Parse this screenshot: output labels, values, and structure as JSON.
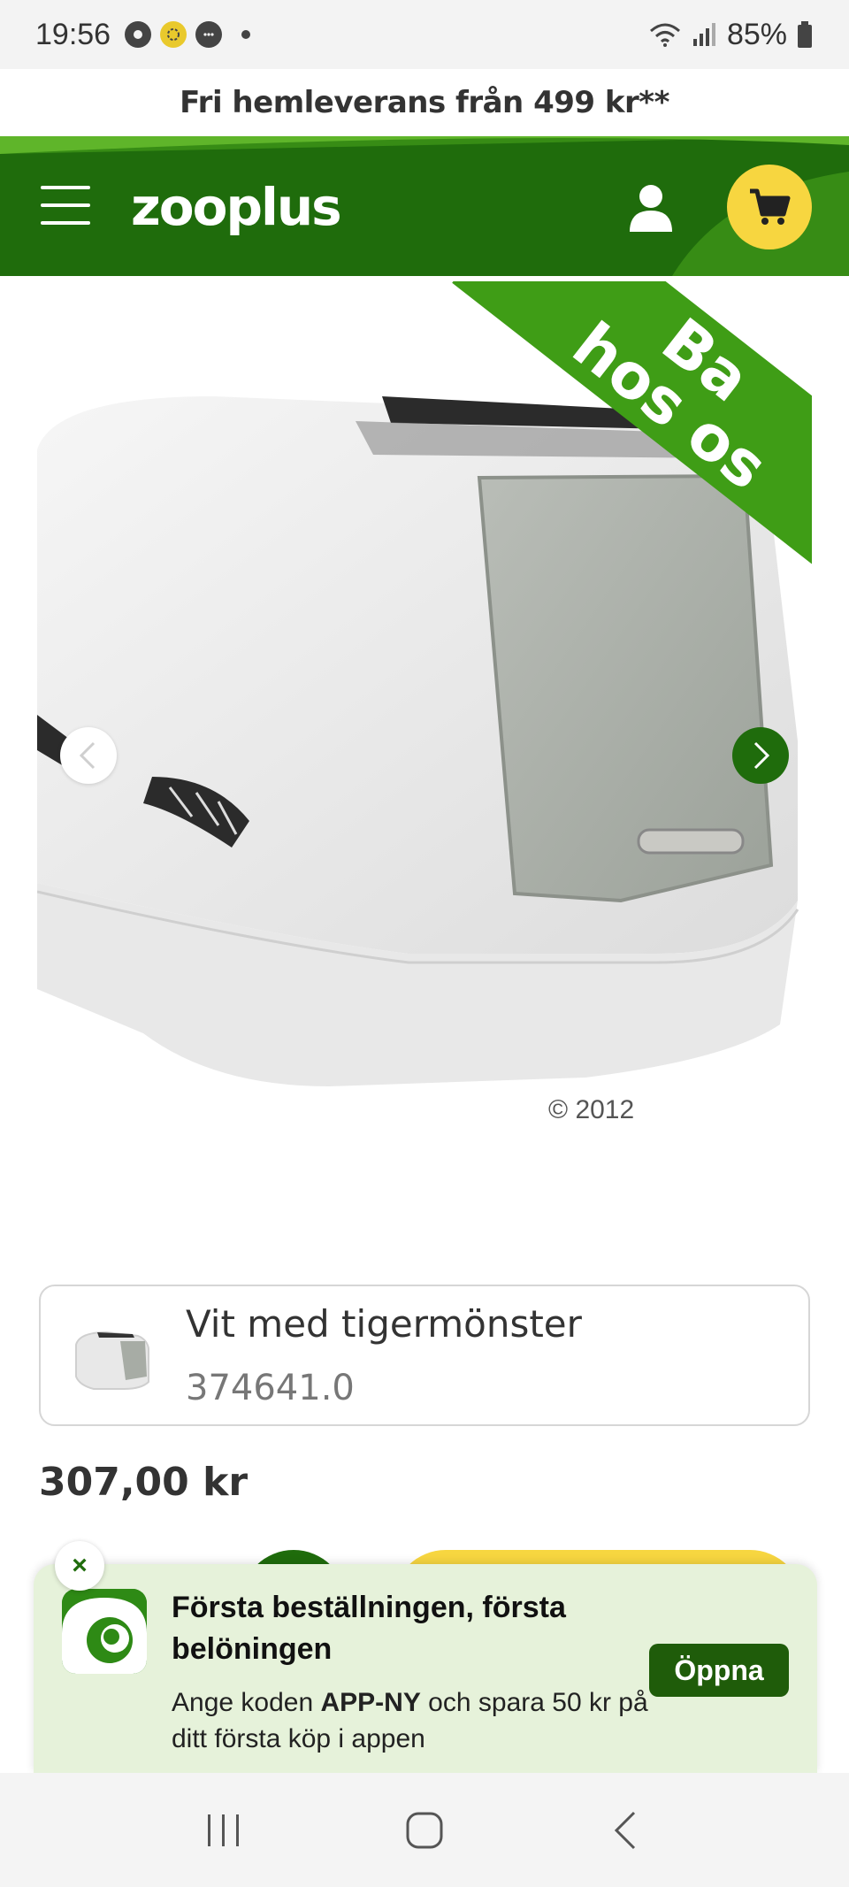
{
  "status_bar": {
    "time": "19:56",
    "battery": "85%",
    "icons": [
      "app-icon",
      "app-icon",
      "chat-icon",
      "dot",
      "wifi-icon",
      "signal-icon",
      "battery-icon"
    ]
  },
  "promo": {
    "text": "Fri hemleverans från 499 kr**"
  },
  "header": {
    "logo": "zooplus",
    "menu_icon": "hamburger-icon",
    "user_icon": "user-icon",
    "cart_icon": "cart-icon"
  },
  "product": {
    "ribbon_text": "Ba\nhos os",
    "copyright": "© 2012",
    "variant": {
      "name": "Vit med tigermönster",
      "sku": "374641.0"
    },
    "price": "307,00 kr"
  },
  "app_banner": {
    "title": "Första beställningen, första belöningen",
    "body_prefix": "Ange koden ",
    "body_code": "APP-NY",
    "body_suffix": " och spara 50 kr på ditt första köp i appen",
    "button_label": "Öppna",
    "close_label": "×"
  },
  "colors": {
    "brand_green": "#1f6c0c",
    "ribbon_green": "#3f9d16",
    "cart_yellow": "#f7d640",
    "sheet_bg": "#e6f2da"
  }
}
